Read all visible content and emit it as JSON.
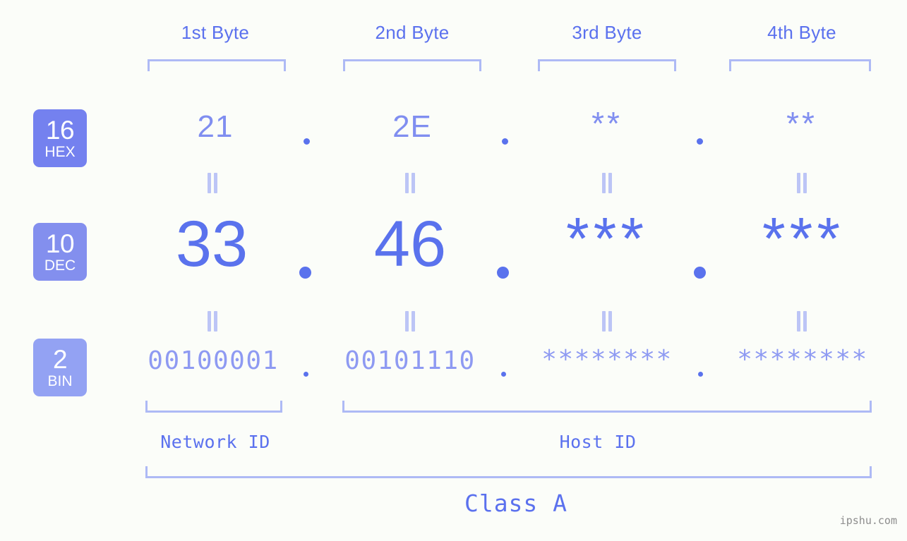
{
  "meta": {
    "background_color": "#fbfdf9",
    "accent_color": "#5a72ed",
    "bracket_color": "#aebaf5",
    "watermark": "ipshu.com"
  },
  "byte_headers": [
    {
      "label": "1st Byte"
    },
    {
      "label": "2nd Byte"
    },
    {
      "label": "3rd Byte"
    },
    {
      "label": "4th Byte"
    }
  ],
  "bases": [
    {
      "key": "hex",
      "number": "16",
      "abbr": "HEX",
      "color": "#7481ef"
    },
    {
      "key": "dec",
      "number": "10",
      "abbr": "DEC",
      "color": "#838fee"
    },
    {
      "key": "bin",
      "number": "2",
      "abbr": "BIN",
      "color": "#93a2f3"
    }
  ],
  "rows": {
    "hex": {
      "values": [
        "21",
        "2E",
        "**",
        "**"
      ],
      "separator": "."
    },
    "dec": {
      "values": [
        "33",
        "46",
        "***",
        "***"
      ],
      "separator": "."
    },
    "bin": {
      "values": [
        "00100001",
        "00101110",
        "********",
        "********"
      ],
      "separator": "."
    }
  },
  "equality_marks": {
    "symbol": "=",
    "count_per_row": 4
  },
  "segments": {
    "network_id": {
      "label": "Network ID"
    },
    "host_id": {
      "label": "Host ID"
    },
    "class": {
      "label": "Class A"
    }
  }
}
